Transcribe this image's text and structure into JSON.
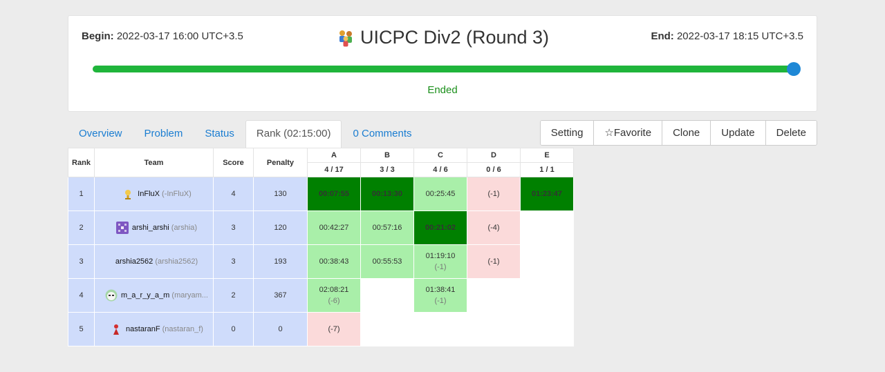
{
  "header": {
    "begin_label": "Begin:",
    "begin_value": "2022-03-17 16:00 UTC+3.5",
    "end_label": "End:",
    "end_value": "2022-03-17 18:15 UTC+3.5",
    "title": "UICPC Div2 (Round 3)",
    "status": "Ended",
    "progress_fraction": 1.0,
    "progress_color": "#1fb53b",
    "knob_color": "#1e88d6",
    "title_icon": "team-people-icon"
  },
  "tabs": [
    {
      "label": "Overview",
      "active": false
    },
    {
      "label": "Problem",
      "active": false
    },
    {
      "label": "Status",
      "active": false
    },
    {
      "label": "Rank (02:15:00)",
      "active": true
    },
    {
      "label": "0 Comments",
      "active": false
    }
  ],
  "actions": [
    {
      "label": "Setting"
    },
    {
      "label": "☆Favorite"
    },
    {
      "label": "Clone"
    },
    {
      "label": "Update"
    },
    {
      "label": "Delete"
    }
  ],
  "table": {
    "headers": {
      "rank": "Rank",
      "team": "Team",
      "score": "Score",
      "penalty": "Penalty"
    },
    "problems": [
      {
        "letter": "A",
        "count": "4 / 17"
      },
      {
        "letter": "B",
        "count": "3 / 3"
      },
      {
        "letter": "C",
        "count": "4 / 6"
      },
      {
        "letter": "D",
        "count": "0 / 6"
      },
      {
        "letter": "E",
        "count": "1 / 1"
      }
    ],
    "rows": [
      {
        "rank": "1",
        "name": "InFluX",
        "user": "(-InFluX)",
        "avatar": "trophy-avatar-icon",
        "score": "4",
        "penalty": "130",
        "cells": [
          {
            "status": "first",
            "time": "00:07:55",
            "sub": ""
          },
          {
            "status": "first",
            "time": "00:13:30",
            "sub": ""
          },
          {
            "status": "ac",
            "time": "00:25:45",
            "sub": ""
          },
          {
            "status": "wa",
            "time": "(-1)",
            "sub": ""
          },
          {
            "status": "first",
            "time": "01:23:47",
            "sub": ""
          }
        ]
      },
      {
        "rank": "2",
        "name": "arshi_arshi",
        "user": "(arshia)",
        "avatar": "pixel-avatar-icon",
        "score": "3",
        "penalty": "120",
        "cells": [
          {
            "status": "ac",
            "time": "00:42:27",
            "sub": ""
          },
          {
            "status": "ac",
            "time": "00:57:16",
            "sub": ""
          },
          {
            "status": "first",
            "time": "00:21:02",
            "sub": ""
          },
          {
            "status": "wa",
            "time": "(-4)",
            "sub": ""
          },
          {
            "status": "empty",
            "time": "",
            "sub": ""
          }
        ]
      },
      {
        "rank": "3",
        "name": "arshia2562",
        "user": "(arshia2562)",
        "avatar": "",
        "score": "3",
        "penalty": "193",
        "cells": [
          {
            "status": "ac",
            "time": "00:38:43",
            "sub": ""
          },
          {
            "status": "ac",
            "time": "00:55:53",
            "sub": ""
          },
          {
            "status": "ac",
            "time": "01:19:10",
            "sub": "(-1)"
          },
          {
            "status": "wa",
            "time": "(-1)",
            "sub": ""
          },
          {
            "status": "empty",
            "time": "",
            "sub": ""
          }
        ]
      },
      {
        "rank": "4",
        "name": "m_a_r_y_a_m",
        "user": "(maryam...",
        "avatar": "face-avatar-icon",
        "score": "2",
        "penalty": "367",
        "cells": [
          {
            "status": "ac",
            "time": "02:08:21",
            "sub": "(-6)"
          },
          {
            "status": "empty",
            "time": "",
            "sub": ""
          },
          {
            "status": "ac",
            "time": "01:38:41",
            "sub": "(-1)"
          },
          {
            "status": "empty",
            "time": "",
            "sub": ""
          },
          {
            "status": "empty",
            "time": "",
            "sub": ""
          }
        ]
      },
      {
        "rank": "5",
        "name": "nastaranF",
        "user": "(nastaran_f)",
        "avatar": "red-figure-avatar-icon",
        "score": "0",
        "penalty": "0",
        "cells": [
          {
            "status": "wa",
            "time": "(-7)",
            "sub": ""
          },
          {
            "status": "empty",
            "time": "",
            "sub": ""
          },
          {
            "status": "empty",
            "time": "",
            "sub": ""
          },
          {
            "status": "empty",
            "time": "",
            "sub": ""
          },
          {
            "status": "empty",
            "time": "",
            "sub": ""
          }
        ]
      }
    ],
    "colors": {
      "first": "#008000",
      "ac": "#a9efa9",
      "wa": "#fbdada",
      "info": "#cfdcfb"
    }
  }
}
